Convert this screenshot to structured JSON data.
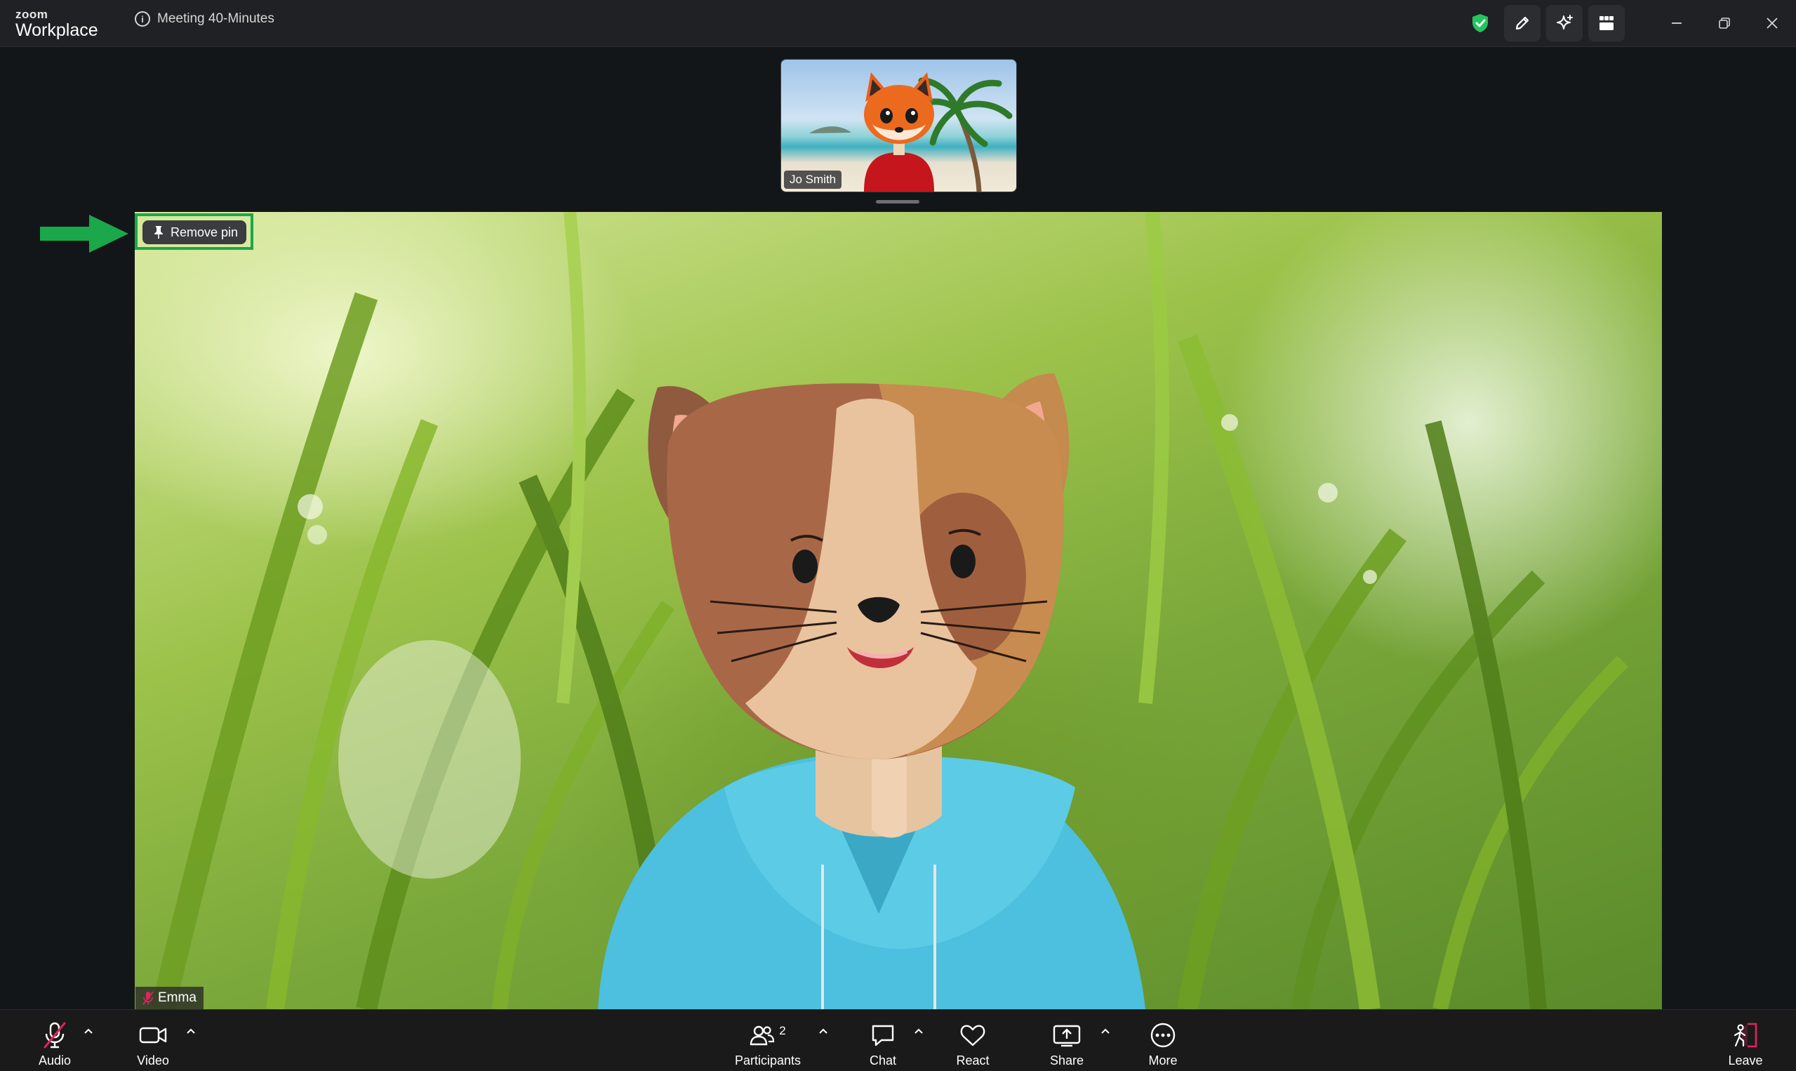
{
  "app": {
    "brand_top": "zoom",
    "brand_bottom": "Workplace",
    "meeting_title": "Meeting 40-Minutes"
  },
  "thumbnail": {
    "participant_name": "Jo Smith"
  },
  "main_video": {
    "participant_name": "Emma",
    "remove_pin_label": "Remove pin",
    "audio_muted": true
  },
  "toolbar": {
    "audio_label": "Audio",
    "video_label": "Video",
    "participants_label": "Participants",
    "participants_count": "2",
    "chat_label": "Chat",
    "react_label": "React",
    "share_label": "Share",
    "more_label": "More",
    "leave_label": "Leave"
  },
  "colors": {
    "highlight": "#1aa84a",
    "security_shield": "#22c55e",
    "muted": "#e0245e",
    "leave": "#e0245e"
  }
}
